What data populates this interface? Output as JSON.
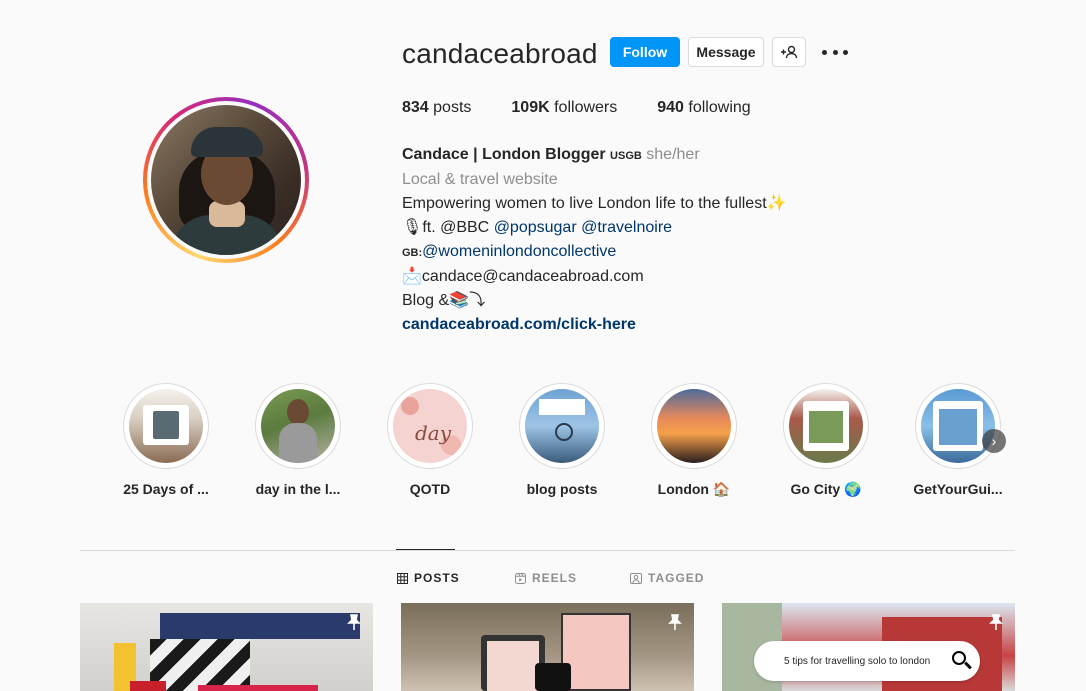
{
  "profile": {
    "username": "candaceabroad",
    "follow_label": "Follow",
    "message_label": "Message",
    "stats": {
      "posts_count": "834",
      "posts_label": "posts",
      "followers_count": "109K",
      "followers_label": "followers",
      "following_count": "940",
      "following_label": "following"
    },
    "bio": {
      "name": "Candace | London Blogger",
      "name_flags": "USGB",
      "pronouns": "she/her",
      "category": "Local & travel website",
      "line1": "Empowering women to live London life to the fullest",
      "line1_emoji": "✨",
      "line2_emoji": "🎙",
      "line2_prefix": "ft. @BBC ",
      "line2_mention1": "@popsugar",
      "line2_mention2": "@travelnoire",
      "line3_flag": "GB:",
      "line3_mention": "@womeninlondoncollective",
      "line4_emoji": "📩",
      "line4_text": "candace@candaceabroad.com",
      "line5_text": "Blog &",
      "line5_emoji": "📚⤵",
      "link": "candaceabroad.com/click-here"
    }
  },
  "highlights": [
    {
      "label": "25 Days of ...",
      "icon": "highlight-25-days"
    },
    {
      "label": "day in the l...",
      "icon": "highlight-day-in-life"
    },
    {
      "label": "QOTD",
      "icon": "highlight-qotd"
    },
    {
      "label": "blog posts",
      "icon": "highlight-blog-posts"
    },
    {
      "label": "London 🏠",
      "icon": "highlight-london"
    },
    {
      "label": "Go City 🌍",
      "icon": "highlight-go-city"
    },
    {
      "label": "GetYourGui...",
      "icon": "highlight-getyourguide"
    }
  ],
  "tabs": {
    "posts": "POSTS",
    "reels": "REELS",
    "tagged": "TAGGED"
  },
  "posts": {
    "post3_search_text": "5 tips for travelling solo to london"
  },
  "colors": {
    "accent": "#0095f6",
    "link": "#00376b",
    "muted": "#8e8e8e"
  }
}
